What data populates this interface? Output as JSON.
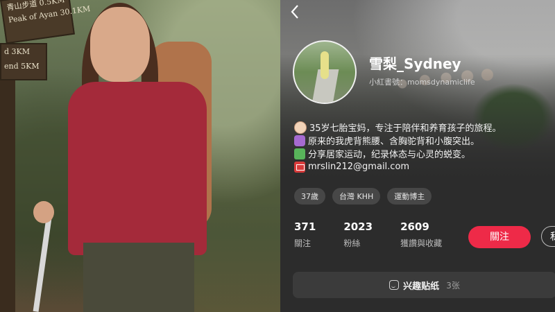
{
  "photo": {
    "sign_lines": [
      "青山步道 0.5KM",
      "Peak of Ayan 30.1KM",
      "d 3KM",
      "end 5KM"
    ]
  },
  "profile": {
    "back_icon": "chevron-left-icon",
    "name": "雪梨_Sydney",
    "red_id": "小紅書號：momsdynamiclife",
    "bio": [
      {
        "icon": "baby-emoji",
        "text": "35岁七胎宝妈，专注于陪伴和养育孩子的旅程。"
      },
      {
        "icon": "pregnant-woman-emoji",
        "text": "原来的我虎背熊腰、含胸驼背和小腹突出。"
      },
      {
        "icon": "running-emoji",
        "text": "分享居家运动，纪录体态与心灵的蜕变。"
      },
      {
        "icon": "mail-emoji",
        "text": "mrslin212@gmail.com"
      }
    ],
    "tags": [
      "37歲",
      "台灣 KHH",
      "運動博主"
    ],
    "stats": [
      {
        "value": "371",
        "label": "關注"
      },
      {
        "value": "2023",
        "label": "粉絲"
      },
      {
        "value": "2609",
        "label": "獲讚與收藏"
      }
    ],
    "follow_label": "關注",
    "message_label": "私",
    "sticker": {
      "label": "兴趣贴纸",
      "count": "3张"
    }
  },
  "colors": {
    "follow_button": "#ee2a48",
    "background": "#2c2c2c",
    "tag_background": "#474747"
  }
}
